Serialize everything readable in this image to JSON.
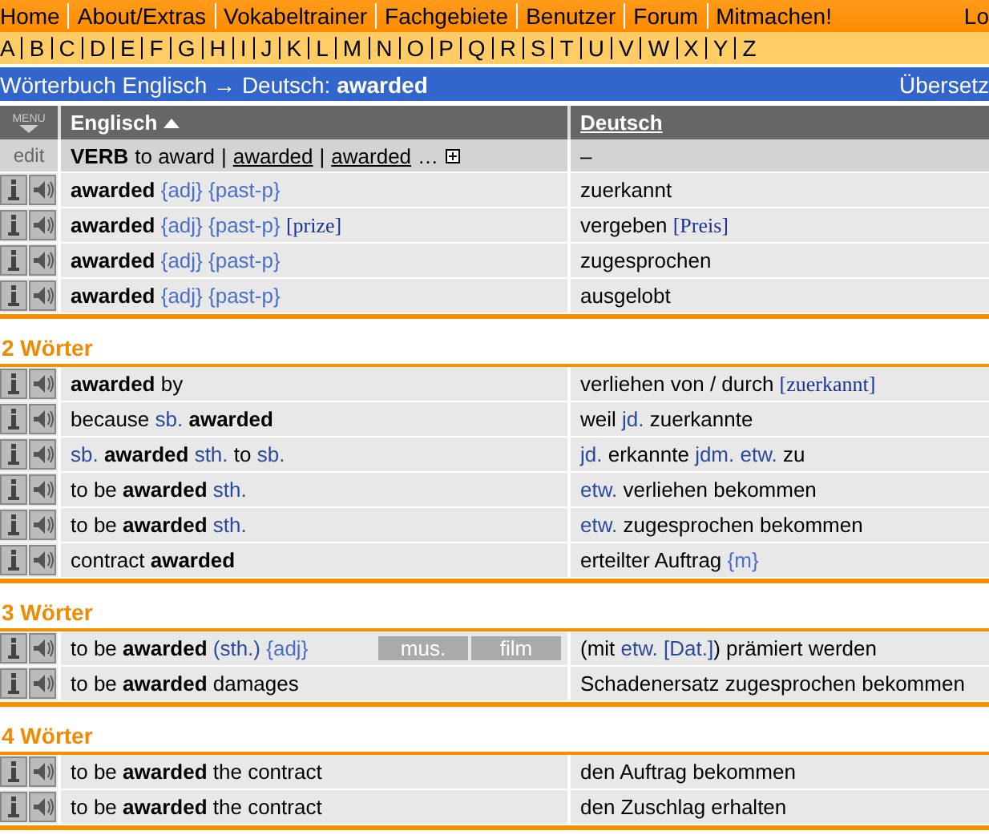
{
  "nav": {
    "links": [
      "Home",
      "About/Extras",
      "Vokabeltrainer",
      "Fachgebiete",
      "Benutzer",
      "Forum",
      "Mitmachen!"
    ],
    "right": "Lo"
  },
  "alphabet": [
    "A",
    "B",
    "C",
    "D",
    "E",
    "F",
    "G",
    "H",
    "I",
    "J",
    "K",
    "L",
    "M",
    "N",
    "O",
    "P",
    "Q",
    "R",
    "S",
    "T",
    "U",
    "V",
    "W",
    "X",
    "Y",
    "Z"
  ],
  "title_bar": {
    "prefix": "Wörterbuch Englisch → Deutsch:",
    "query": "awarded",
    "right": "Übersetz"
  },
  "table": {
    "menu_label": "MENU",
    "columns": [
      {
        "label": "Englisch",
        "sorted": true
      },
      {
        "label": "Deutsch",
        "sorted": false
      }
    ],
    "verb_row": {
      "edit": "edit",
      "pos": "VERB",
      "base": "to award",
      "separator": "|",
      "forms": [
        "awarded",
        "awarded"
      ],
      "more": "…",
      "german": "–"
    },
    "sections": [
      {
        "rows": [
          {
            "en": [
              {
                "kind": "bold",
                "text": "awarded "
              },
              {
                "kind": "note",
                "text": "{adj} {past-p}"
              }
            ],
            "de": [
              {
                "kind": "plain",
                "text": "zuerkannt"
              }
            ]
          },
          {
            "en": [
              {
                "kind": "bold",
                "text": "awarded "
              },
              {
                "kind": "note",
                "text": "{adj} {past-p} "
              },
              {
                "kind": "serif",
                "text": "[prize]"
              }
            ],
            "de": [
              {
                "kind": "plain",
                "text": "vergeben "
              },
              {
                "kind": "serif",
                "text": "[Preis]"
              }
            ]
          },
          {
            "en": [
              {
                "kind": "bold",
                "text": "awarded "
              },
              {
                "kind": "note",
                "text": "{adj} {past-p}"
              }
            ],
            "de": [
              {
                "kind": "plain",
                "text": "zugesprochen"
              }
            ]
          },
          {
            "en": [
              {
                "kind": "bold",
                "text": "awarded "
              },
              {
                "kind": "note",
                "text": "{adj} {past-p}"
              }
            ],
            "de": [
              {
                "kind": "plain",
                "text": "ausgelobt"
              }
            ]
          }
        ]
      },
      {
        "heading": "2 Wörter",
        "rows": [
          {
            "en": [
              {
                "kind": "bold",
                "text": "awarded"
              },
              {
                "kind": "plain",
                "text": " by"
              }
            ],
            "de": [
              {
                "kind": "plain",
                "text": "verliehen von / durch "
              },
              {
                "kind": "serif",
                "text": "[zuerkannt]"
              }
            ]
          },
          {
            "en": [
              {
                "kind": "plain",
                "text": "because "
              },
              {
                "kind": "abbr",
                "text": "sb."
              },
              {
                "kind": "bold",
                "text": " awarded"
              }
            ],
            "de": [
              {
                "kind": "plain",
                "text": "weil "
              },
              {
                "kind": "abbr",
                "text": "jd."
              },
              {
                "kind": "plain",
                "text": " zuerkannte"
              }
            ]
          },
          {
            "en": [
              {
                "kind": "abbr",
                "text": "sb."
              },
              {
                "kind": "bold",
                "text": " awarded "
              },
              {
                "kind": "abbr",
                "text": "sth."
              },
              {
                "kind": "plain",
                "text": " to "
              },
              {
                "kind": "abbr",
                "text": "sb."
              }
            ],
            "de": [
              {
                "kind": "abbr",
                "text": "jd."
              },
              {
                "kind": "plain",
                "text": " erkannte "
              },
              {
                "kind": "abbr",
                "text": "jdm. etw."
              },
              {
                "kind": "plain",
                "text": " zu"
              }
            ]
          },
          {
            "en": [
              {
                "kind": "plain",
                "text": "to be "
              },
              {
                "kind": "bold",
                "text": "awarded "
              },
              {
                "kind": "abbr",
                "text": "sth."
              }
            ],
            "de": [
              {
                "kind": "abbr",
                "text": "etw."
              },
              {
                "kind": "plain",
                "text": " verliehen bekommen"
              }
            ]
          },
          {
            "en": [
              {
                "kind": "plain",
                "text": "to be "
              },
              {
                "kind": "bold",
                "text": "awarded "
              },
              {
                "kind": "abbr",
                "text": "sth."
              }
            ],
            "de": [
              {
                "kind": "abbr",
                "text": "etw."
              },
              {
                "kind": "plain",
                "text": " zugesprochen bekommen"
              }
            ]
          },
          {
            "en": [
              {
                "kind": "plain",
                "text": "contract "
              },
              {
                "kind": "bold",
                "text": "awarded"
              }
            ],
            "de": [
              {
                "kind": "plain",
                "text": "erteilter Auftrag "
              },
              {
                "kind": "note",
                "text": "{m}"
              }
            ]
          }
        ]
      },
      {
        "heading": "3 Wörter",
        "rows": [
          {
            "en": [
              {
                "kind": "plain",
                "text": "to be "
              },
              {
                "kind": "bold",
                "text": "awarded "
              },
              {
                "kind": "abbr",
                "text": "(sth.) "
              },
              {
                "kind": "note",
                "text": "{adj}"
              }
            ],
            "tags": [
              "mus.",
              "film"
            ],
            "de": [
              {
                "kind": "plain",
                "text": "(mit "
              },
              {
                "kind": "abbr",
                "text": "etw. [Dat.]"
              },
              {
                "kind": "plain",
                "text": ") prämiert werden"
              }
            ]
          },
          {
            "en": [
              {
                "kind": "plain",
                "text": "to be "
              },
              {
                "kind": "bold",
                "text": "awarded"
              },
              {
                "kind": "plain",
                "text": " damages"
              }
            ],
            "de": [
              {
                "kind": "plain",
                "text": "Schadenersatz zugesprochen bekommen"
              }
            ]
          }
        ]
      },
      {
        "heading": "4 Wörter",
        "rows": [
          {
            "en": [
              {
                "kind": "plain",
                "text": "to be "
              },
              {
                "kind": "bold",
                "text": "awarded"
              },
              {
                "kind": "plain",
                "text": " the contract"
              }
            ],
            "de": [
              {
                "kind": "plain",
                "text": "den Auftrag bekommen"
              }
            ]
          },
          {
            "en": [
              {
                "kind": "plain",
                "text": "to be "
              },
              {
                "kind": "bold",
                "text": "awarded"
              },
              {
                "kind": "plain",
                "text": " the contract"
              }
            ],
            "de": [
              {
                "kind": "plain",
                "text": "den Zuschlag erhalten"
              }
            ]
          }
        ]
      }
    ]
  }
}
